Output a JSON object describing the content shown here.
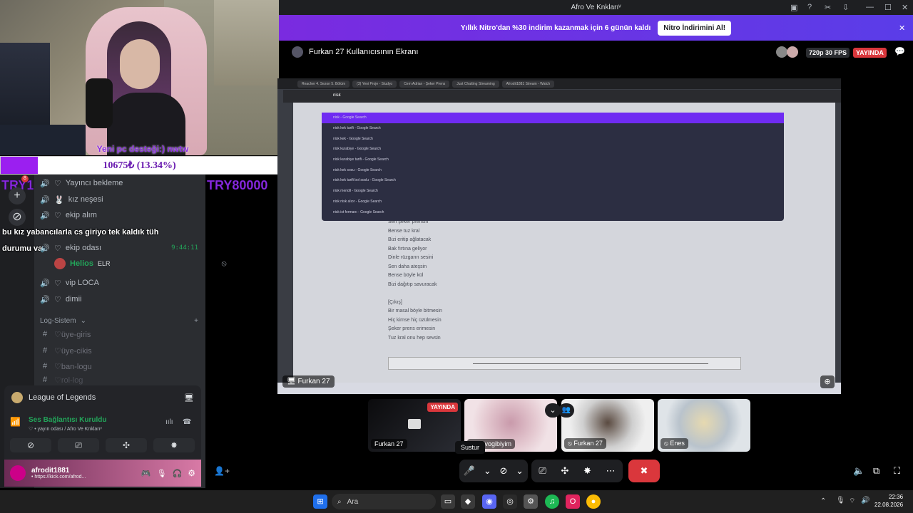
{
  "webcam": {
    "caption": "Yeni pc desteği:) nwtw",
    "donation_text": "10675₺ (13.34%)",
    "donation_progress": 0.1334,
    "left_label": "TRY1",
    "right_label": "TRY80000"
  },
  "rail": {
    "add_icon": "+",
    "explore_icon": "compass-icon",
    "badge": "8"
  },
  "channels": {
    "voice_channels": [
      {
        "name": "Yayıncı bekleme",
        "prefix": "♡"
      },
      {
        "name": "kız neşesi",
        "prefix": "🐰"
      },
      {
        "name": "ekip alım",
        "prefix": "♡"
      },
      {
        "name": "ekip odası",
        "prefix": "♡",
        "time": "9:44:11"
      },
      {
        "name": "vip LOCA",
        "prefix": "♡"
      },
      {
        "name": "dimii",
        "prefix": "♡"
      }
    ],
    "voice_user": {
      "name": "Helios",
      "badge": "ELR"
    },
    "overlay_chat_1": "bu kız yabancılarla cs giriyo tek kaldık tüh",
    "overlay_chat_2": "durumu var",
    "category": "Log-Sistem",
    "text_channels": [
      "♡üye-giris",
      "♡üye-cikis",
      "♡ban-logu",
      "♡rol-log"
    ]
  },
  "activity": {
    "title": "League of Legends"
  },
  "voice_status": {
    "title": "Ses Bağlantısı Kuruldu",
    "subtitle": "♡ • yayın odası / Afro Ve Knklarıᵛ"
  },
  "user": {
    "name": "afrodit1881",
    "status": "• https://kick.com/afrod..."
  },
  "window": {
    "title": "Afro Ve Knklarıᵛ"
  },
  "nitro": {
    "text": "Yıllık Nitro'dan %30 indirim kazanmak için 6 günün kaldı",
    "button": "Nitro İndirimini Al!"
  },
  "stream": {
    "title": "Furkan 27 Kullanıcısının Ekranı",
    "quality": "720p 30 FPS",
    "live": "YAYINDA",
    "name_label": "Furkan 27"
  },
  "browser": {
    "tabs": [
      "Reacher 4. Sezon 5. Bölüm",
      "(3) Yeni Proje - Studyo",
      "Cem Adrian - Şeker Prens",
      "Just Chatting Streaming",
      "Afrodit1881 Stream - Watch"
    ],
    "query": "nisk",
    "suggestions": [
      "nisk - Google Search",
      "nisk kek tarifi - Google Search",
      "nisk kek - Google Search",
      "nisk kurabiye - Google Search",
      "nisk kurabiye tarifi - Google Search",
      "nisk kek sosu - Google Search",
      "nisk kek tarifi bol soslu - Google Search",
      "nisk mendil - Google Search",
      "nisk nisk alıor - Google Search",
      "nisk ist fermanı - Google Search"
    ],
    "lyrics": [
      "Sen şeker prensin",
      "Bense tuz kral",
      "Bizi eritip ağlatacak",
      "Bak fırtına geliyor",
      "Dinle rüzgarın sesini",
      "Sen daha ateşsin",
      "Bense böyle kül",
      "Bizi dağıtıp savuracak",
      "",
      "[Çıkış]",
      "Bir masal böyle bitmesin",
      "Hiç kimse hiç üzülmesin",
      "Şeker prens erimesin",
      "Tuz kral onu hep sevsin"
    ]
  },
  "tiles": [
    {
      "label": "Furkan 27",
      "live": "YAYINDA"
    },
    {
      "label": "ersalvogibiyim"
    },
    {
      "label": "Furkan 27"
    },
    {
      "label": "Enes"
    }
  ],
  "tooltip": "Sustur",
  "taskbar": {
    "search": "Ara",
    "time": "22:36",
    "date": "22.08.2026"
  },
  "colors": {
    "accent": "#5865f2",
    "live": "#da373c",
    "online": "#23a55a",
    "nitro": "#7a2be0"
  }
}
